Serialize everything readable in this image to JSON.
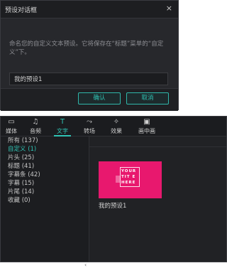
{
  "dialog": {
    "title": "预设对话框",
    "close_glyph": "×",
    "message": "命名您的自定义文本预设。它将保存在“标题”菜单的“自定义”下。",
    "input_value": "我的预设1",
    "ok_label": "确认",
    "cancel_label": "取消"
  },
  "panel": {
    "tabs": [
      {
        "label": "媒体",
        "icon": "folder-icon",
        "glyph": "▭"
      },
      {
        "label": "音频",
        "icon": "music-note-icon",
        "glyph": "♫"
      },
      {
        "label": "文字",
        "icon": "text-icon",
        "glyph": "T"
      },
      {
        "label": "转场",
        "icon": "transition-icon",
        "glyph": "⤳"
      },
      {
        "label": "效果",
        "icon": "effects-icon",
        "glyph": "✧"
      },
      {
        "label": "画中画",
        "icon": "picture-icon",
        "glyph": "▣"
      }
    ],
    "active_tab": "文字",
    "categories": [
      "所有 (137)",
      "自定义 (1)",
      "片头 (25)",
      "标题 (41)",
      "字幕条 (42)",
      "字幕 (15)",
      "片尾 (14)",
      "收藏 (0)"
    ],
    "active_category": "自定义 (1)",
    "collapse_glyph": "‹",
    "preset": {
      "label": "我的预设1",
      "thumb_text": "YOUR TITLE HERE",
      "thumb_lines": [
        "YOUR",
        "TIT E",
        "HERE"
      ]
    },
    "accent": "#2fc3b4"
  }
}
